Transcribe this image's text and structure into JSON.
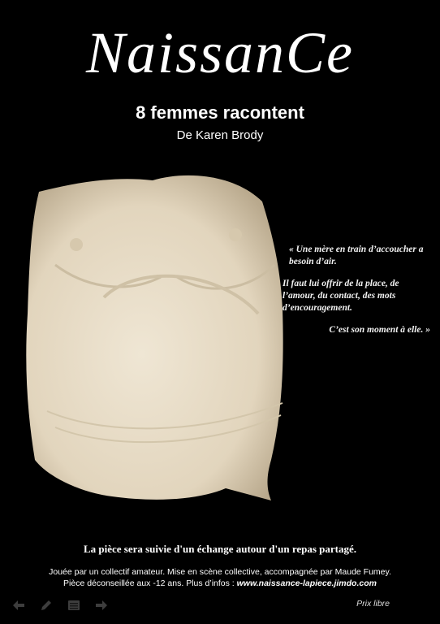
{
  "poster": {
    "title": "NaissanCe",
    "subtitle": "8 femmes racontent",
    "author": "De Karen Brody",
    "quote": {
      "line1": "« Une mère en train d’accoucher a besoin d’air.",
      "line2": "Il faut lui offrir de la place, de l’amour, du contact, des mots d’encouragement.",
      "line3": "C’est son moment à elle. »"
    },
    "meal_note": "La pièce sera suivie d'un échange autour d'un repas partagé.",
    "info_line1": "Jouée par un collectif amateur.  Mise en scène collective, accompagnée par Maude Fumey.",
    "info_line2_prefix": "Pièce déconseillée aux -12 ans.  Plus d’infos : ",
    "url": "www.naissance-lapiece.jimdo.com",
    "price": "Prix libre"
  },
  "toolbar_icons": [
    "arrow-left-icon",
    "pencil-icon",
    "menu-icon",
    "arrow-right-icon"
  ],
  "colors": {
    "background": "#000000",
    "text": "#ffffff",
    "cast": "#e6dac4"
  }
}
